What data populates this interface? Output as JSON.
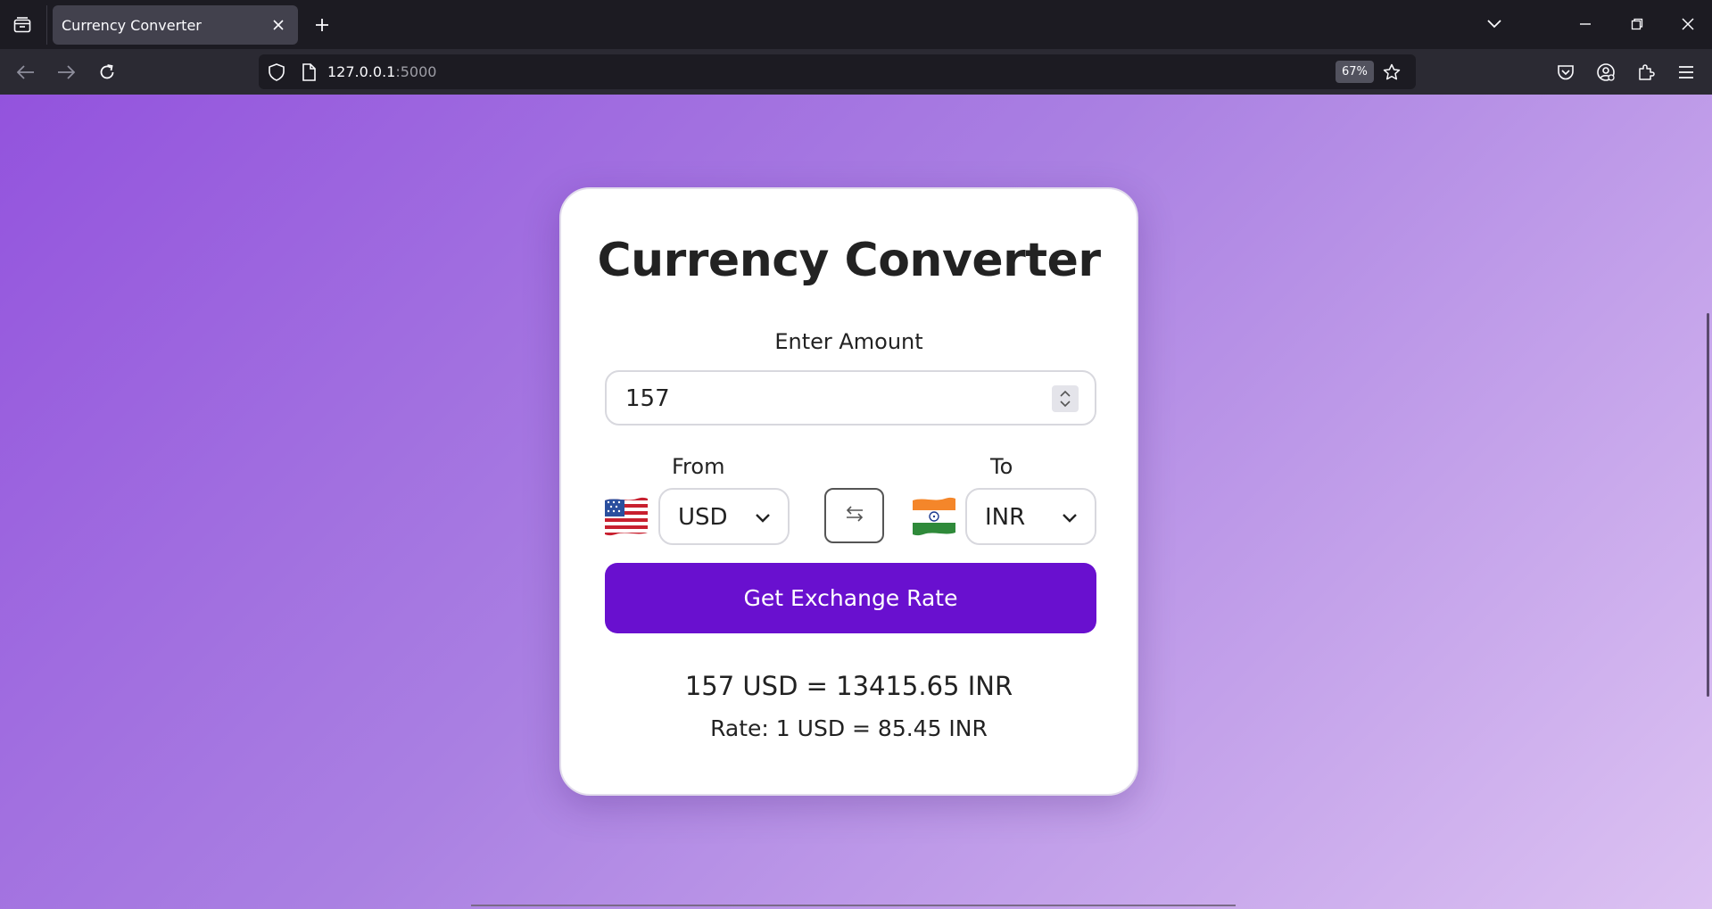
{
  "browser": {
    "tab_title": "Currency Converter",
    "url_host": "127.0.0.1",
    "url_port": ":5000",
    "zoom": "67%"
  },
  "converter": {
    "title": "Currency Converter",
    "amount_label": "Enter Amount",
    "amount_value": "157",
    "from_label": "From",
    "to_label": "To",
    "from_currency": "USD",
    "to_currency": "INR",
    "from_flag": "us-flag",
    "to_flag": "india-flag",
    "swap_icon": "swap-arrows-icon",
    "button_label": "Get Exchange Rate",
    "result": "157 USD = 13415.65 INR",
    "rate": "Rate: 1 USD = 85.45 INR"
  },
  "colors": {
    "button": "#6910cf",
    "gradient_start": "#9353dd",
    "gradient_end": "#dcc2f2",
    "card": "#ffffff"
  }
}
